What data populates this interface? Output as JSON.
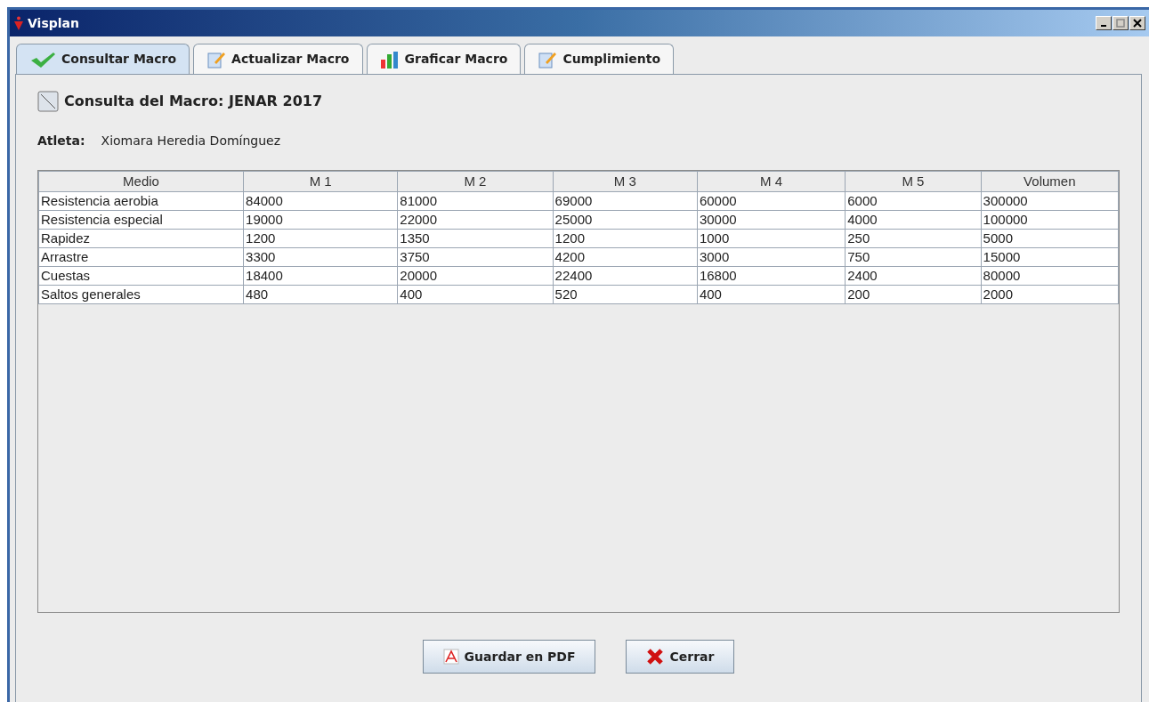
{
  "window": {
    "title": "Visplan"
  },
  "tabs": [
    {
      "label": "Consultar Macro",
      "selected": true
    },
    {
      "label": "Actualizar Macro",
      "selected": false
    },
    {
      "label": "Graficar Macro",
      "selected": false
    },
    {
      "label": "Cumplimiento",
      "selected": false
    }
  ],
  "heading": "Consulta del Macro: JENAR 2017",
  "athlete": {
    "label": "Atleta:",
    "value": "Xiomara Heredia Domínguez"
  },
  "table": {
    "columns": [
      "Medio",
      "M 1",
      "M 2",
      "M 3",
      "M 4",
      "M 5",
      "Volumen"
    ],
    "rows": [
      [
        "Resistencia aerobia",
        "84000",
        "81000",
        "69000",
        "60000",
        "6000",
        "300000"
      ],
      [
        "Resistencia especial",
        "19000",
        "22000",
        "25000",
        "30000",
        "4000",
        "100000"
      ],
      [
        "Rapidez",
        "1200",
        "1350",
        "1200",
        "1000",
        "250",
        "5000"
      ],
      [
        "Arrastre",
        "3300",
        "3750",
        "4200",
        "3000",
        "750",
        "15000"
      ],
      [
        "Cuestas",
        "18400",
        "20000",
        "22400",
        "16800",
        "2400",
        "80000"
      ],
      [
        "Saltos generales",
        "480",
        "400",
        "520",
        "400",
        "200",
        "2000"
      ]
    ]
  },
  "buttons": [
    "Guardar en PDF",
    "Cerrar"
  ]
}
